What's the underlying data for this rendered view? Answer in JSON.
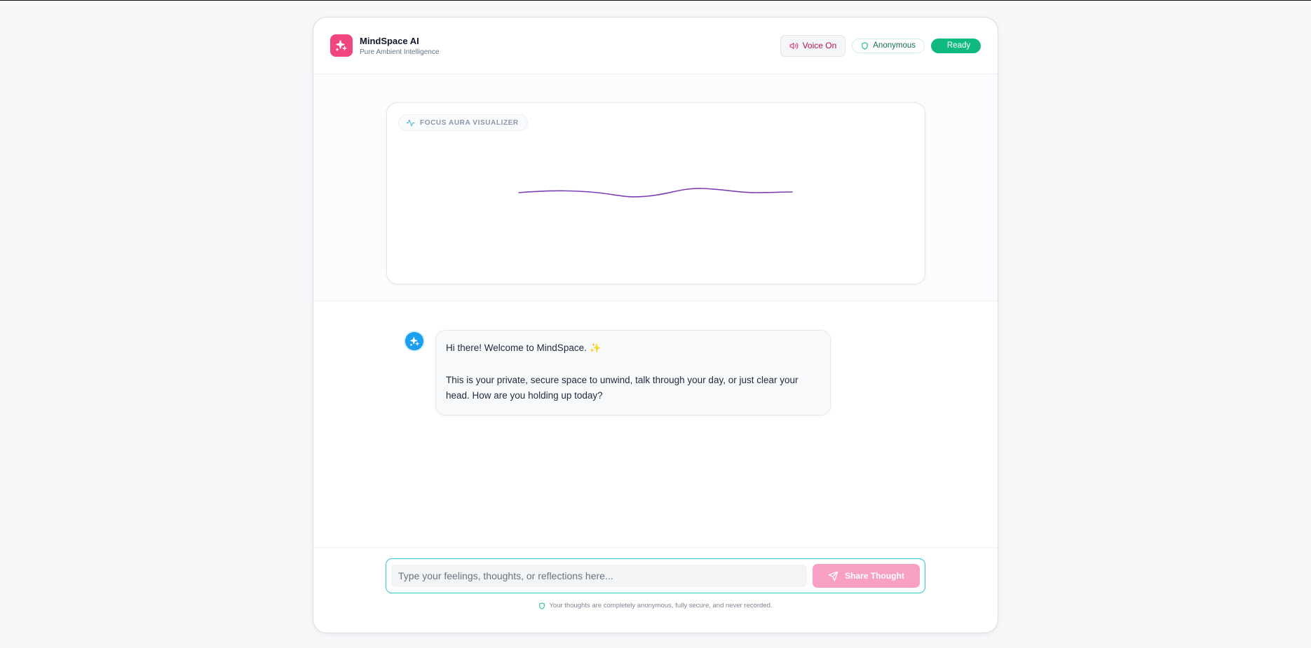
{
  "colors": {
    "brand_pink": "#f0467e",
    "accent_cyan": "#2dc7d6",
    "ready_green": "#10b981",
    "wave_purple": "#7e3fb4",
    "avatar_blue": "#1b9ff0"
  },
  "header": {
    "logo_icon": "sparkles-icon",
    "title": "MindSpace AI",
    "subtitle": "Pure Ambient Intelligence",
    "voice_label": "Voice On",
    "voice_icon": "speaker-icon",
    "anonymous_label": "Anonymous",
    "anonymous_icon": "shield-icon",
    "status_label": "Ready"
  },
  "visualizer": {
    "label": "FOCUS AURA VISUALIZER",
    "icon": "activity-icon"
  },
  "chat": {
    "messages": [
      {
        "sender": "assistant",
        "avatar_icon": "sparkles-icon",
        "line1": "Hi there! Welcome to MindSpace. ✨",
        "line2": "This is your private, secure space to unwind, talk through your day, or just clear your head. How are you holding up today?"
      }
    ]
  },
  "composer": {
    "placeholder": "Type your feelings, thoughts, or reflections here...",
    "value": "",
    "send_label": "Share Thought",
    "send_icon": "send-icon"
  },
  "footer": {
    "note": "Your thoughts are completely anonymous, fully secure, and never recorded.",
    "note_icon": "shield-icon"
  }
}
